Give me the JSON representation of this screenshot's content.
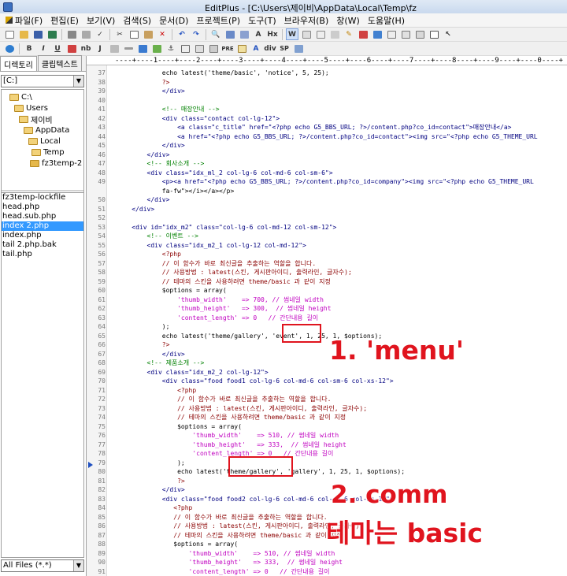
{
  "window": {
    "title": "EditPlus - [C:\\Users\\제이비\\AppData\\Local\\Temp\\fz"
  },
  "menu": [
    "파일(F)",
    "편집(E)",
    "보기(V)",
    "검색(S)",
    "문서(D)",
    "프로젝트(P)",
    "도구(T)",
    "브라우저(B)",
    "창(W)",
    "도움말(H)"
  ],
  "toolbar2_labels": {
    "bold": "B",
    "italic": "I",
    "underline": "U",
    "nb": "nb",
    "justify": "J",
    "heading": "Hx",
    "pre": "PRE",
    "anchor": "A",
    "div": "div",
    "sp": "SP"
  },
  "sidebar": {
    "tabs": [
      "디렉토리",
      "클립텍스트"
    ],
    "drive": "[C:]",
    "folders": [
      "C:\\",
      "Users",
      "제이비",
      "AppData",
      "Local",
      "Temp",
      "fz3temp-2"
    ],
    "files": [
      "fz3temp-lockfile",
      "head.php",
      "head.sub.php",
      "index 2.php",
      "index.php",
      "tail 2.php.bak",
      "tail.php"
    ],
    "selected_file": "index 2.php",
    "filter": "All Files (*.*)"
  },
  "ruler": "----+----1----+----2----+----3----+----4----+----5----+----6----+----7----+----8----+----9----+----0----+",
  "code": [
    {
      "n": "37",
      "t": "            echo latest('theme/basic', 'notice', 5, 25);"
    },
    {
      "n": "38",
      "t": "            ?>"
    },
    {
      "n": "39",
      "t": "            </div>"
    },
    {
      "n": "40",
      "t": ""
    },
    {
      "n": "41",
      "t": "            <!-- 매장안내 -->"
    },
    {
      "n": "42",
      "t": "            <div class=\"contact col-lg-12\">"
    },
    {
      "n": "43",
      "t": "                <a class=\"c_title\" href=\"<?php echo G5_BBS_URL; ?>/content.php?co_id=contact\">매장안내</a>"
    },
    {
      "n": "44",
      "t": "                <a href=\"<?php echo G5_BBS_URL; ?>/content.php?co_id=contact\"><img src=\"<?php echo G5_THEME_URL"
    },
    {
      "n": "45",
      "t": "            </div>"
    },
    {
      "n": "46",
      "t": "        </div>"
    },
    {
      "n": "47",
      "t": "        <!-- 회사소개 -->"
    },
    {
      "n": "48",
      "t": "        <div class=\"idx_ml_2 col-lg-6 col-md-6 col-sm-6\">"
    },
    {
      "n": "49",
      "t": "            <p><a href=\"<?php echo G5_BBS_URL; ?>/content.php?co_id=company\"><img src=\"<?php echo G5_THEME_URL"
    },
    {
      "n": "",
      "t": "            fa-fw\"></i></a></p>"
    },
    {
      "n": "50",
      "t": "        </div>"
    },
    {
      "n": "51",
      "t": "    </div>"
    },
    {
      "n": "52",
      "t": ""
    },
    {
      "n": "53",
      "t": "    <div id=\"idx_m2\" class=\"col-lg-6 col-md-12 col-sm-12\">"
    },
    {
      "n": "54",
      "t": "        <!-- 이벤트 -->"
    },
    {
      "n": "55",
      "t": "        <div class=\"idx_m2_1 col-lg-12 col-md-12\">"
    },
    {
      "n": "56",
      "t": "            <?php"
    },
    {
      "n": "57",
      "t": "            // 이 함수가 바로 최신글을 추출하는 역할을 합니다."
    },
    {
      "n": "58",
      "t": "            // 사용방법 : latest(스킨, 게시판아이디, 출력라인, 글자수);"
    },
    {
      "n": "59",
      "t": "            // 테마의 스킨을 사용하려면 theme/basic 과 같이 지정"
    },
    {
      "n": "60",
      "t": "            $options = array("
    },
    {
      "n": "61",
      "t": "                'thumb_width'    => 700, // 썸네일 width"
    },
    {
      "n": "62",
      "t": "                'thumb_height'   => 300,  // 썸네일 height"
    },
    {
      "n": "63",
      "t": "                'content_length' => 0   // 간단내용 길이"
    },
    {
      "n": "64",
      "t": "            );"
    },
    {
      "n": "65",
      "t": "            echo latest('theme/gallery', 'event', 1, 25, 1, $options);"
    },
    {
      "n": "66",
      "t": "            ?>"
    },
    {
      "n": "67",
      "t": "            </div>"
    },
    {
      "n": "68",
      "t": "        <!-- 제품소개 -->"
    },
    {
      "n": "69",
      "t": "        <div class=\"idx_m2_2 col-lg-12\">"
    },
    {
      "n": "70",
      "t": "            <div class=\"food food1 col-lg-6 col-md-6 col-sm-6 col-xs-12\">"
    },
    {
      "n": "71",
      "t": "                <?php"
    },
    {
      "n": "72",
      "t": "                // 이 함수가 바로 최신글을 추출하는 역할을 합니다."
    },
    {
      "n": "73",
      "t": "                // 사용방법 : latest(스킨, 게시판아이디, 출력라인, 글자수);"
    },
    {
      "n": "74",
      "t": "                // 테마의 스킨을 사용하려면 theme/basic 과 같이 지정"
    },
    {
      "n": "75",
      "t": "                $options = array("
    },
    {
      "n": "76",
      "t": "                    'thumb_width'    => 510, // 썸네일 width"
    },
    {
      "n": "77",
      "t": "                    'thumb_height'   => 333,  // 썸네일 height"
    },
    {
      "n": "78",
      "t": "                    'content_length' => 0   // 간단내용 길이"
    },
    {
      "n": "79",
      "t": "                );"
    },
    {
      "n": "80",
      "t": "                echo latest('theme/gallery', 'gallery', 1, 25, 1, $options);"
    },
    {
      "n": "81",
      "t": "                ?>"
    },
    {
      "n": "82",
      "t": "            </div>"
    },
    {
      "n": "83",
      "t": "            <div class=\"food food2 col-lg-6 col-md-6 col-sm-6 col-xs-12\">"
    },
    {
      "n": "84",
      "t": "               <?php"
    },
    {
      "n": "85",
      "t": "               // 이 함수가 바로 최신글을 추출하는 역할을 합니다."
    },
    {
      "n": "86",
      "t": "               // 사용방법 : latest(스킨, 게시판아이디, 출력라인, 글자수);"
    },
    {
      "n": "87",
      "t": "               // 테마의 스킨을 사용하려면 theme/basic 과 같이 지정"
    },
    {
      "n": "88",
      "t": "               $options = array("
    },
    {
      "n": "89",
      "t": "                   'thumb_width'    => 510, // 썸네일 width"
    },
    {
      "n": "90",
      "t": "                   'thumb_height'   => 333,  // 썸네일 height"
    },
    {
      "n": "91",
      "t": "                   'content_length' => 0   // 간단내용 길이"
    }
  ],
  "annotations": {
    "first": "1. 'menu'",
    "second": "2. comm",
    "third": "테마는 basic"
  },
  "colors": {
    "accent": "#e0141e",
    "selection": "#3399ff"
  }
}
